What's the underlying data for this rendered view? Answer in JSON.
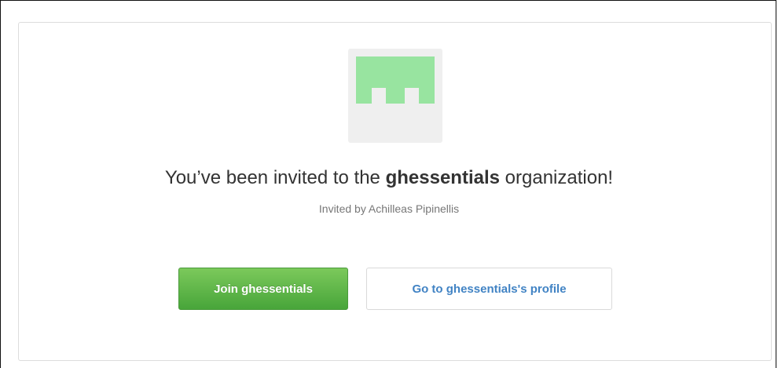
{
  "invitation": {
    "headline_prefix": "You’ve been invited to the ",
    "org_name": "ghessentials",
    "headline_suffix": " organization!",
    "invited_by": "Invited by Achilleas Pipinellis"
  },
  "actions": {
    "join_label": "Join ghessentials",
    "profile_label": "Go to ghessentials's profile"
  },
  "avatar": {
    "icon": "identicon",
    "color": "#98e4a0",
    "background": "#efefef"
  },
  "colors": {
    "primary_button": "#56b43f",
    "link": "#4183c4",
    "text": "#333333",
    "muted_text": "#777777"
  }
}
